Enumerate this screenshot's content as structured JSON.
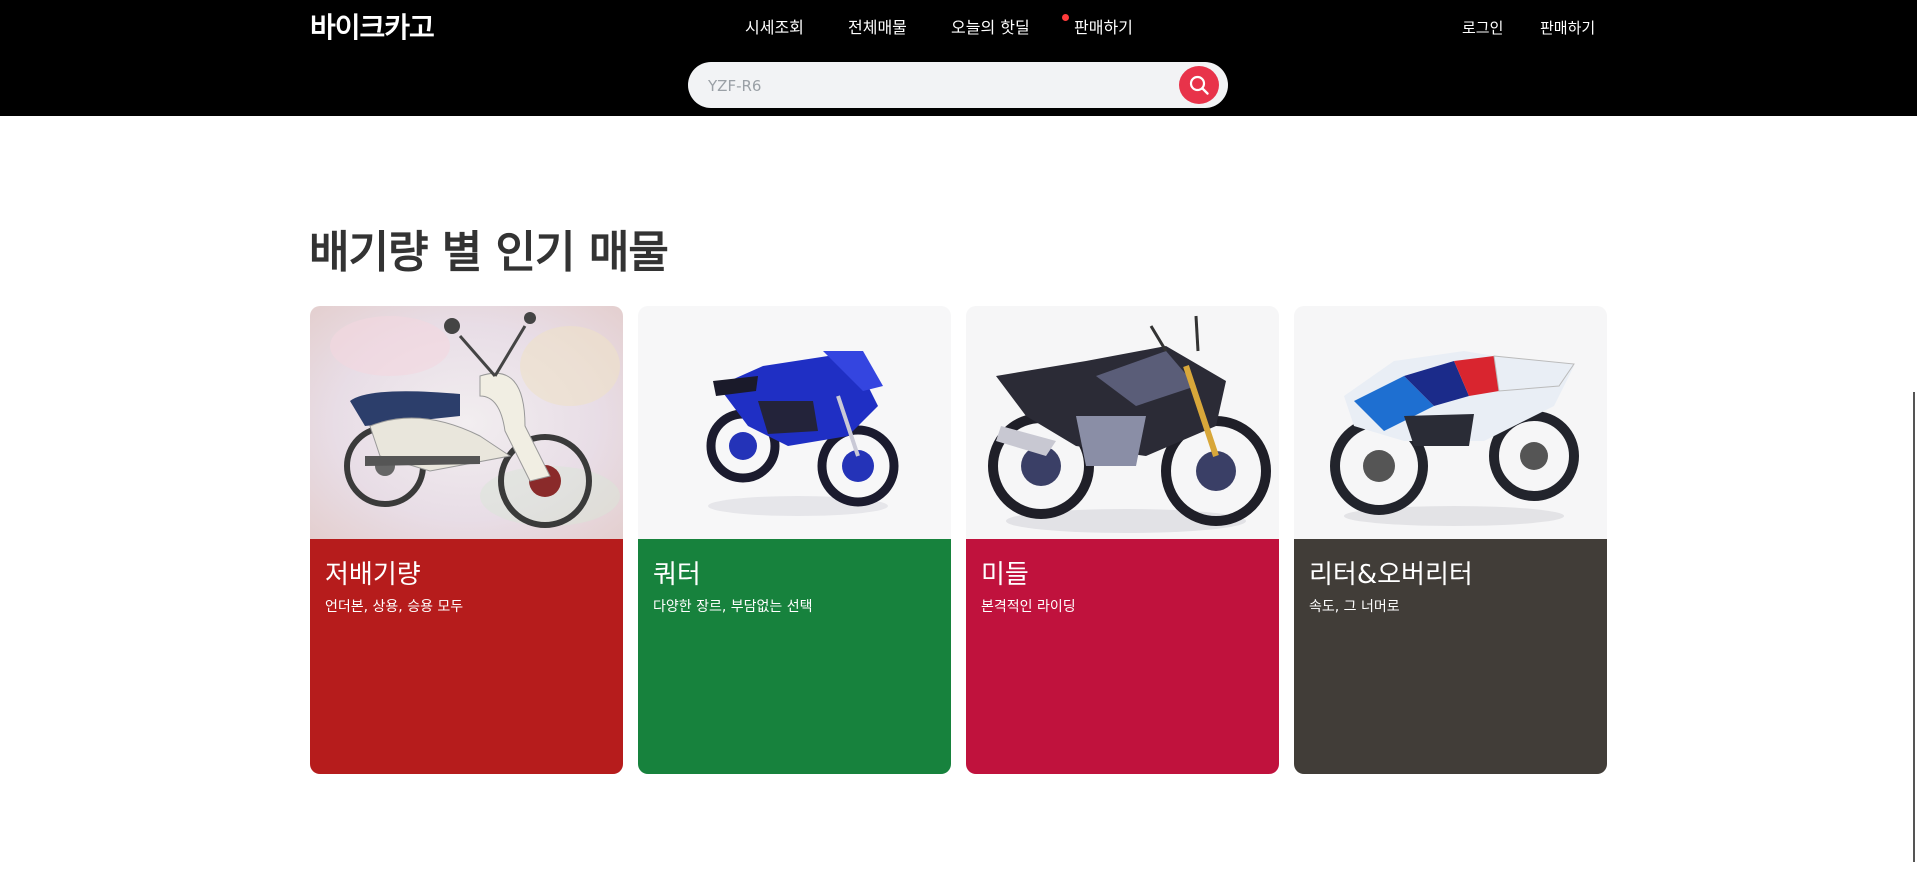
{
  "header": {
    "logo": "바이크카고",
    "nav": [
      "시세조회",
      "전체매물",
      "오늘의 핫딜",
      "판매하기"
    ],
    "auth": [
      "로그인",
      "판매하기"
    ],
    "search": {
      "placeholder": "YZF-R6"
    }
  },
  "section": {
    "title": "배기량 별 인기 매물",
    "cards": [
      {
        "name": "저배기량",
        "desc": "언더본, 상용, 승용 모두",
        "color": "#b61c1c"
      },
      {
        "name": "쿼터",
        "desc": "다양한 장르, 부담없는 선택",
        "color": "#17823d"
      },
      {
        "name": "미들",
        "desc": "본격적인 라이딩",
        "color": "#c0123d"
      },
      {
        "name": "리터&오버리터",
        "desc": "속도, 그 너머로",
        "color": "#413d38"
      }
    ]
  },
  "colors": {
    "header_bg": "#000000",
    "search_button": "#e8334a",
    "nav_dot": "#ff3b3b"
  }
}
